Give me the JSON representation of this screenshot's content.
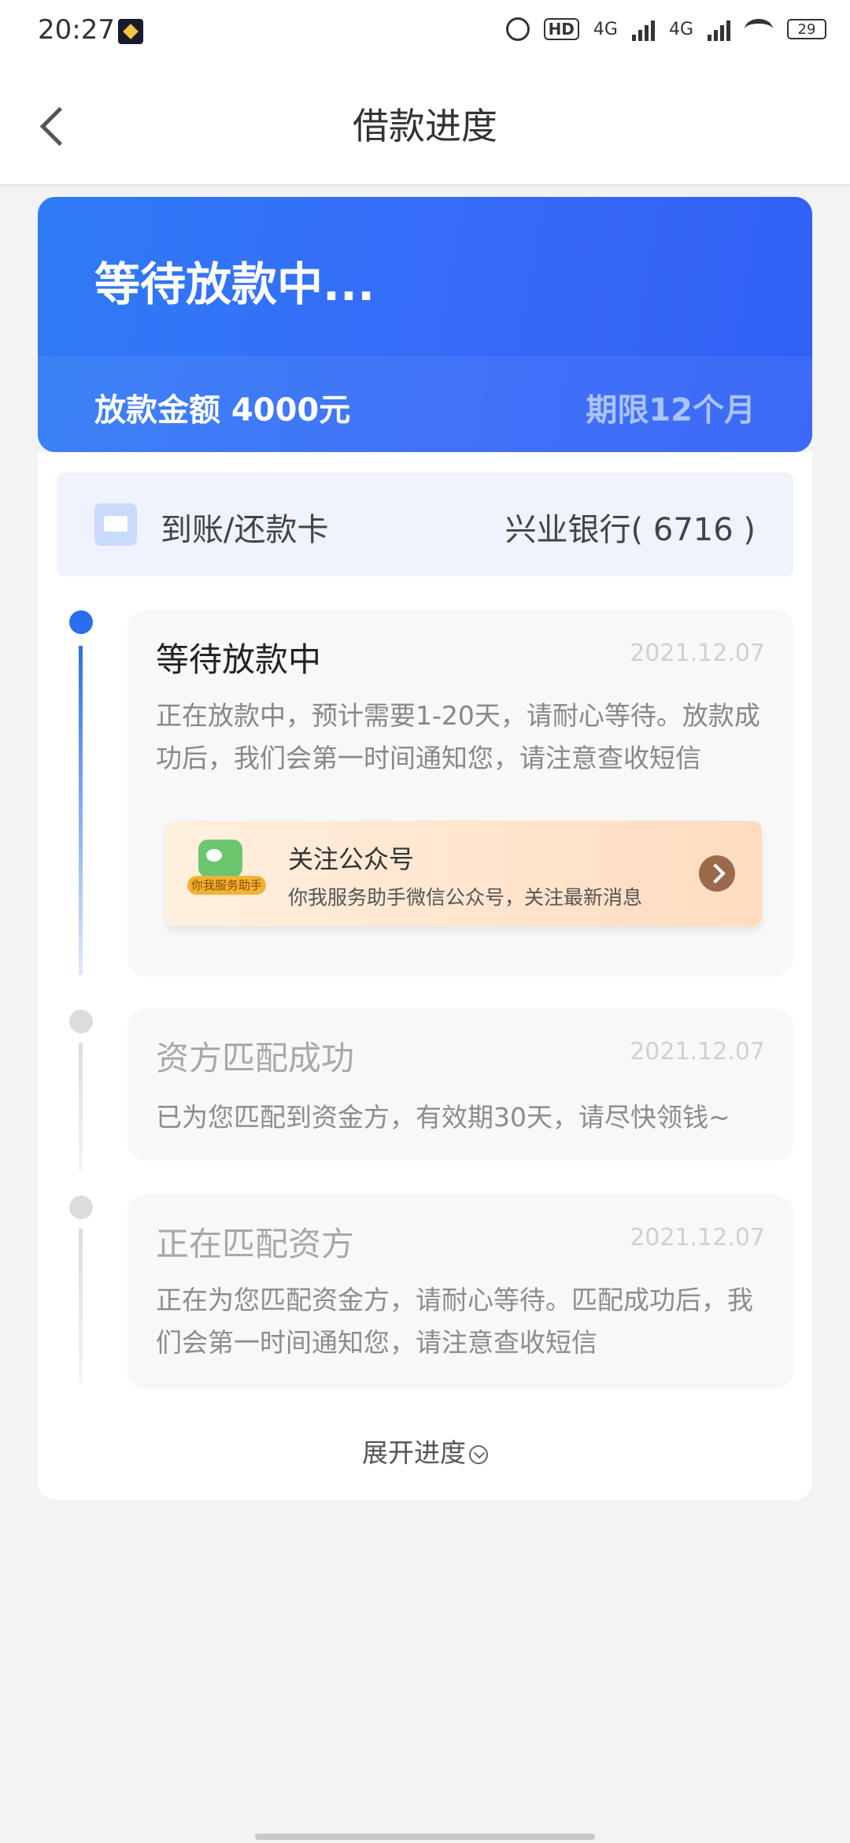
{
  "status_bar": {
    "time": "20:27",
    "hd_label": "HD",
    "network_1": "4G",
    "network_2": "4G",
    "battery": "29"
  },
  "header": {
    "title": "借款进度"
  },
  "hero": {
    "status": "等待放款中...",
    "amount": "放款金额 4000元",
    "term": "期限12个月",
    "accent_color": "#3370f7"
  },
  "bank_card": {
    "label": "到账/还款卡",
    "value": "兴业银行( 6716 )"
  },
  "timeline": [
    {
      "title": "等待放款中",
      "date": "2021.12.07",
      "desc": "正在放款中，预计需要1-20天，请耐心等待。放款成功后，我们会第一时间通知您，请注意查收短信",
      "active": true
    },
    {
      "title": "资方匹配成功",
      "date": "2021.12.07",
      "desc": "已为您匹配到资金方，有效期30天，请尽快领钱~",
      "active": false
    },
    {
      "title": "正在匹配资方",
      "date": "2021.12.07",
      "desc": "正在为您匹配资金方，请耐心等待。匹配成功后，我们会第一时间通知您，请注意查收短信",
      "active": false
    }
  ],
  "promo": {
    "title": "关注公众号",
    "subtitle": "你我服务助手微信公众号，关注最新消息",
    "badge": "你我服务助手",
    "icon": "wechat-icon"
  },
  "expand": {
    "label": "展开进度"
  }
}
